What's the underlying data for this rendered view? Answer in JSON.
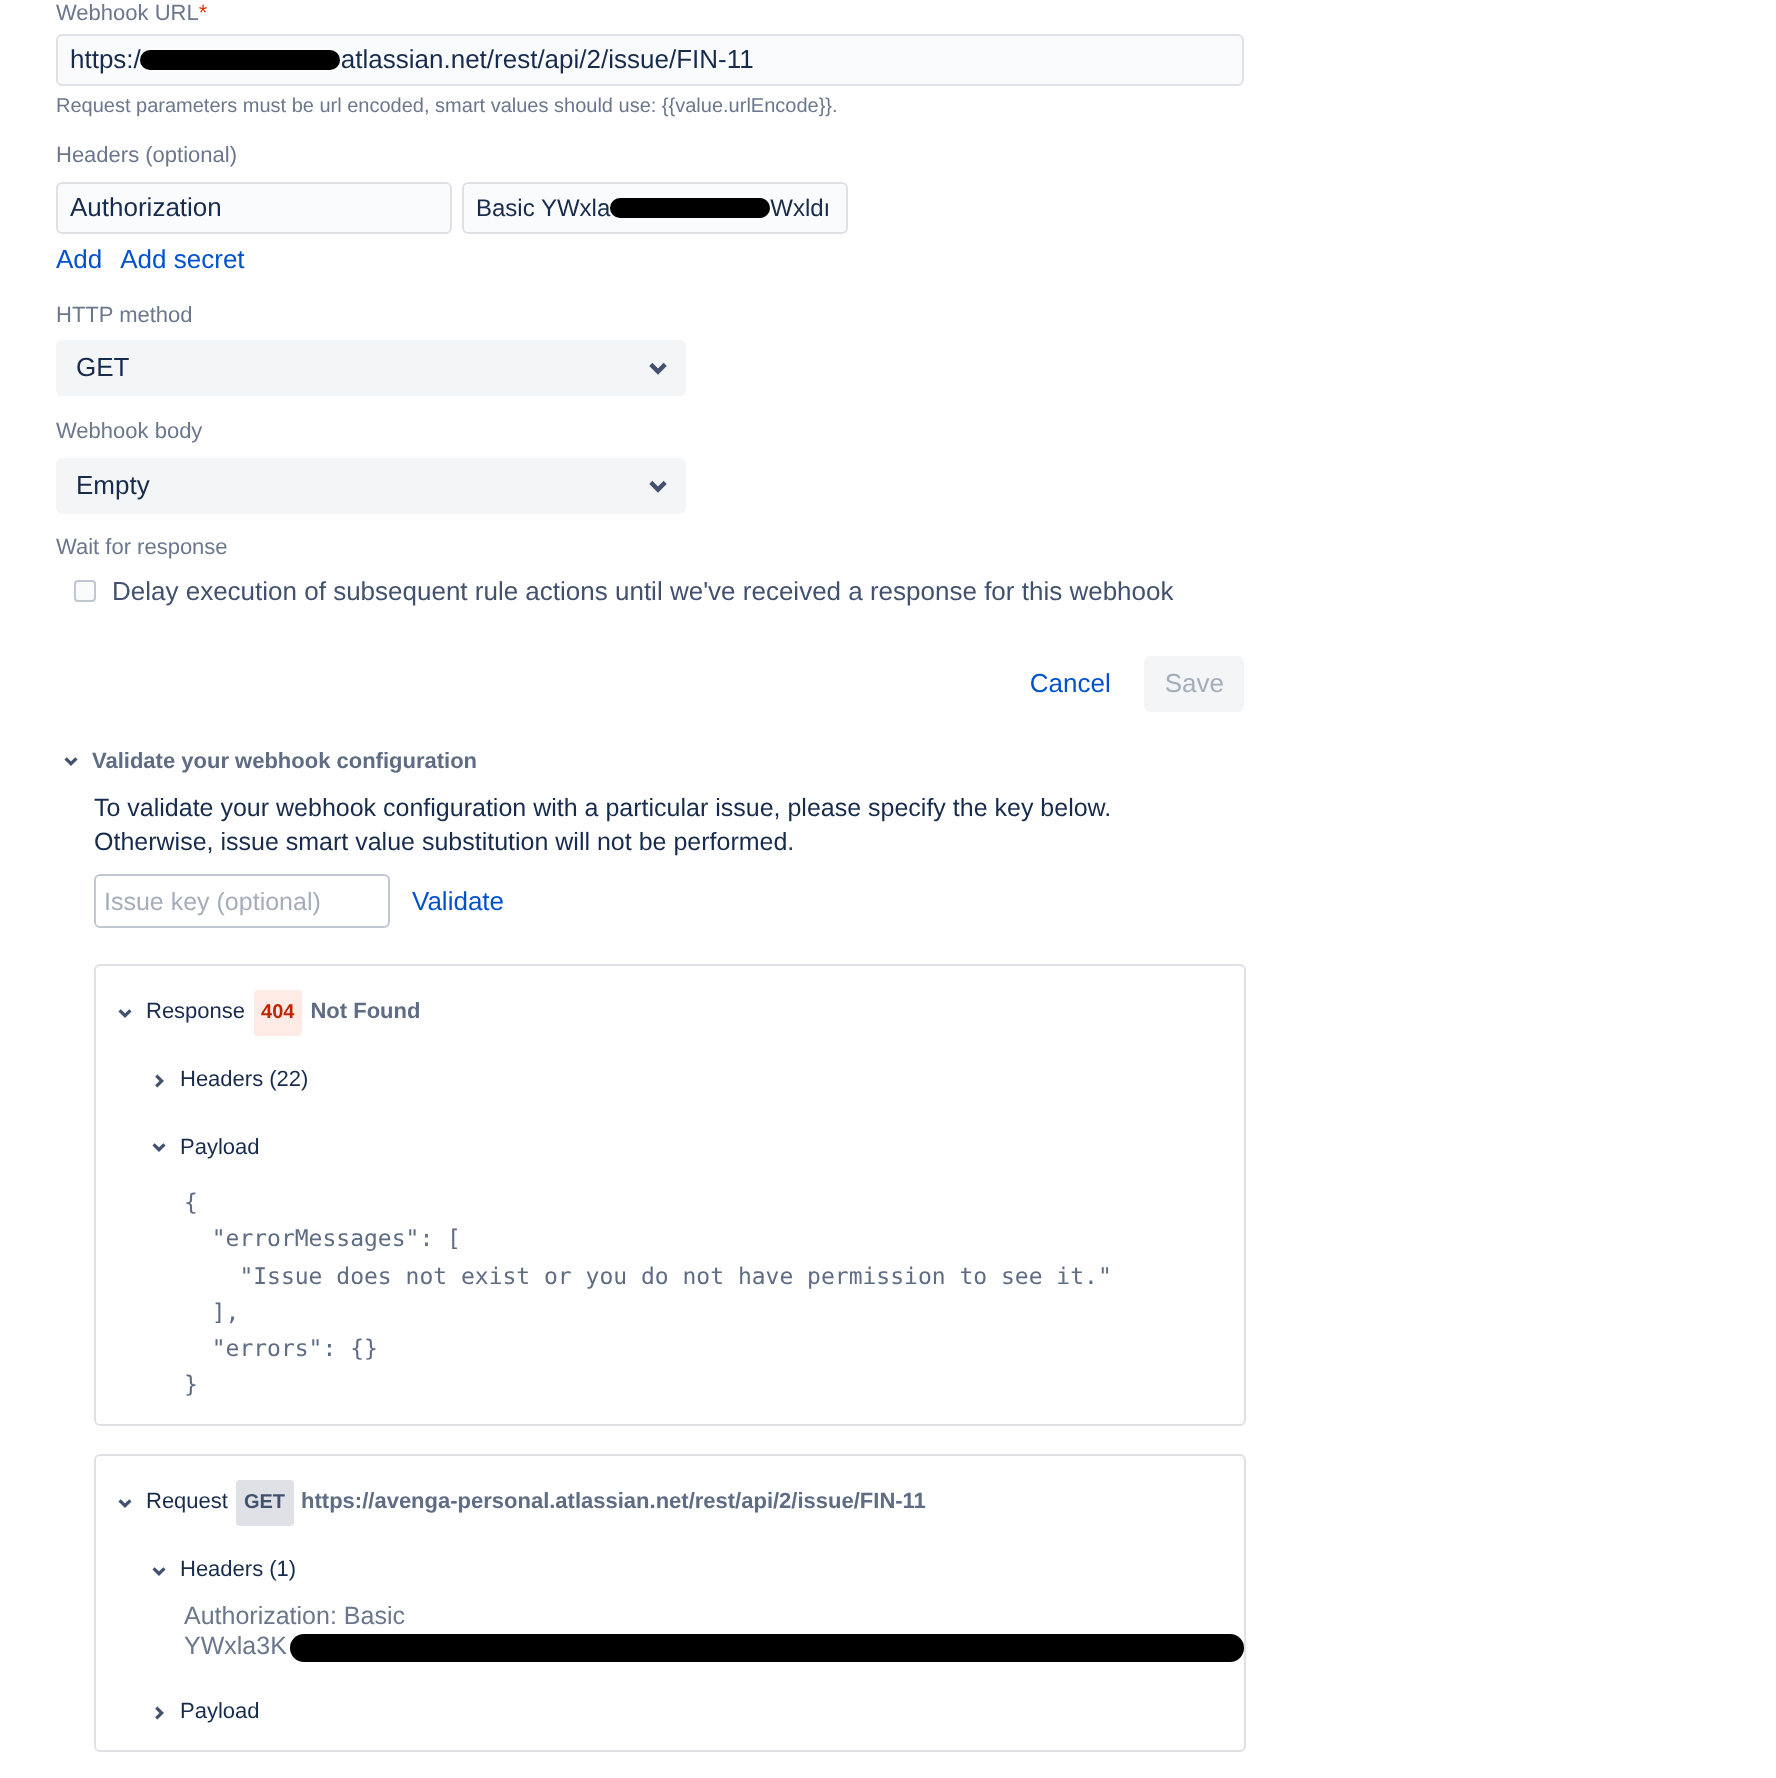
{
  "webhook_url": {
    "label": "Webhook URL",
    "required_mark": "*",
    "value_start": "https:/",
    "value_end": "atlassian.net/rest/api/2/issue/FIN-11",
    "redacted": true,
    "help": "Request parameters must be url encoded, smart values should use: {{value.urlEncode}}."
  },
  "headers": {
    "label": "Headers (optional)",
    "name": "Authorization",
    "value_start": "Basic YWxla",
    "value_end": "Wxldı",
    "redacted": true,
    "links": [
      "Add",
      "Add secret"
    ]
  },
  "http_method": {
    "label": "HTTP method",
    "value": "GET"
  },
  "webhook_body": {
    "label": "Webhook body",
    "value": "Empty"
  },
  "wait": {
    "label": "Wait for response",
    "checkbox": "Delay execution of subsequent rule actions until we've received a response for this webhook",
    "checked": false
  },
  "actions": [
    {
      "label": "Cancel",
      "kind": "link",
      "disabled": false
    },
    {
      "label": "Save",
      "kind": "button",
      "disabled": true
    }
  ],
  "validate": {
    "title": "Validate your webhook configuration",
    "expanded": true,
    "text": [
      "To validate your webhook configuration with a particular issue, please specify the key below.",
      "Otherwise, issue smart value substitution will not be performed."
    ],
    "placeholder": "Issue key (optional)",
    "button": "Validate"
  },
  "panels": [
    {
      "title": "Response",
      "badge": "404",
      "kind": "error",
      "detail": "Not Found",
      "expanded": true,
      "children": [
        {
          "title": "Headers (22)",
          "expanded": false
        },
        {
          "title": "Payload",
          "expanded": true,
          "kind": "code",
          "lines": [
            "{",
            "  \"errorMessages\": [",
            "    \"Issue does not exist or you do not have permission to see it.\"",
            "  ],",
            "  \"errors\": {}",
            "}"
          ]
        }
      ]
    },
    {
      "title": "Request",
      "badge": "GET",
      "kind": "neutral",
      "detail": "https://avenga-personal.atlassian.net/rest/api/2/issue/FIN-11",
      "expanded": true,
      "children": [
        {
          "title": "Headers (1)",
          "expanded": true,
          "kind": "text",
          "lines": [
            "Authorization: Basic",
            "YWxla3K"
          ],
          "redacted": true
        },
        {
          "title": "Payload",
          "expanded": false
        }
      ]
    }
  ]
}
